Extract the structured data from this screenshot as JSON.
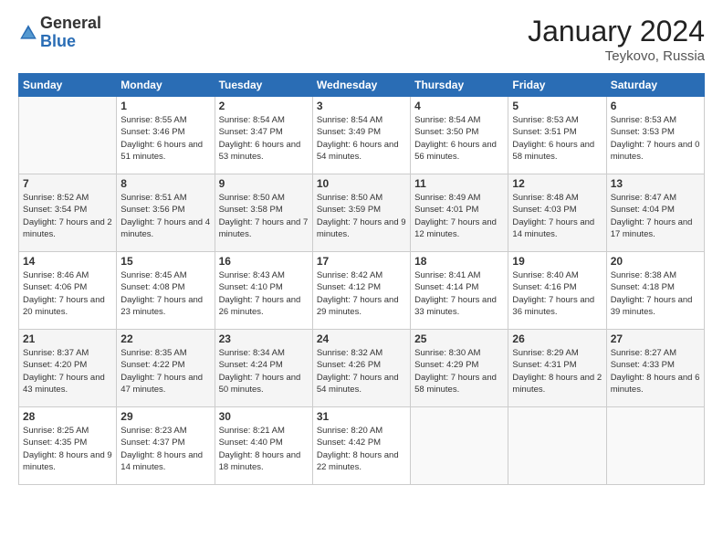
{
  "header": {
    "logo_general": "General",
    "logo_blue": "Blue",
    "month_title": "January 2024",
    "location": "Teykovo, Russia"
  },
  "days_of_week": [
    "Sunday",
    "Monday",
    "Tuesday",
    "Wednesday",
    "Thursday",
    "Friday",
    "Saturday"
  ],
  "weeks": [
    [
      {
        "day": "",
        "sunrise": "",
        "sunset": "",
        "daylight": ""
      },
      {
        "day": "1",
        "sunrise": "Sunrise: 8:55 AM",
        "sunset": "Sunset: 3:46 PM",
        "daylight": "Daylight: 6 hours and 51 minutes."
      },
      {
        "day": "2",
        "sunrise": "Sunrise: 8:54 AM",
        "sunset": "Sunset: 3:47 PM",
        "daylight": "Daylight: 6 hours and 53 minutes."
      },
      {
        "day": "3",
        "sunrise": "Sunrise: 8:54 AM",
        "sunset": "Sunset: 3:49 PM",
        "daylight": "Daylight: 6 hours and 54 minutes."
      },
      {
        "day": "4",
        "sunrise": "Sunrise: 8:54 AM",
        "sunset": "Sunset: 3:50 PM",
        "daylight": "Daylight: 6 hours and 56 minutes."
      },
      {
        "day": "5",
        "sunrise": "Sunrise: 8:53 AM",
        "sunset": "Sunset: 3:51 PM",
        "daylight": "Daylight: 6 hours and 58 minutes."
      },
      {
        "day": "6",
        "sunrise": "Sunrise: 8:53 AM",
        "sunset": "Sunset: 3:53 PM",
        "daylight": "Daylight: 7 hours and 0 minutes."
      }
    ],
    [
      {
        "day": "7",
        "sunrise": "Sunrise: 8:52 AM",
        "sunset": "Sunset: 3:54 PM",
        "daylight": "Daylight: 7 hours and 2 minutes."
      },
      {
        "day": "8",
        "sunrise": "Sunrise: 8:51 AM",
        "sunset": "Sunset: 3:56 PM",
        "daylight": "Daylight: 7 hours and 4 minutes."
      },
      {
        "day": "9",
        "sunrise": "Sunrise: 8:50 AM",
        "sunset": "Sunset: 3:58 PM",
        "daylight": "Daylight: 7 hours and 7 minutes."
      },
      {
        "day": "10",
        "sunrise": "Sunrise: 8:50 AM",
        "sunset": "Sunset: 3:59 PM",
        "daylight": "Daylight: 7 hours and 9 minutes."
      },
      {
        "day": "11",
        "sunrise": "Sunrise: 8:49 AM",
        "sunset": "Sunset: 4:01 PM",
        "daylight": "Daylight: 7 hours and 12 minutes."
      },
      {
        "day": "12",
        "sunrise": "Sunrise: 8:48 AM",
        "sunset": "Sunset: 4:03 PM",
        "daylight": "Daylight: 7 hours and 14 minutes."
      },
      {
        "day": "13",
        "sunrise": "Sunrise: 8:47 AM",
        "sunset": "Sunset: 4:04 PM",
        "daylight": "Daylight: 7 hours and 17 minutes."
      }
    ],
    [
      {
        "day": "14",
        "sunrise": "Sunrise: 8:46 AM",
        "sunset": "Sunset: 4:06 PM",
        "daylight": "Daylight: 7 hours and 20 minutes."
      },
      {
        "day": "15",
        "sunrise": "Sunrise: 8:45 AM",
        "sunset": "Sunset: 4:08 PM",
        "daylight": "Daylight: 7 hours and 23 minutes."
      },
      {
        "day": "16",
        "sunrise": "Sunrise: 8:43 AM",
        "sunset": "Sunset: 4:10 PM",
        "daylight": "Daylight: 7 hours and 26 minutes."
      },
      {
        "day": "17",
        "sunrise": "Sunrise: 8:42 AM",
        "sunset": "Sunset: 4:12 PM",
        "daylight": "Daylight: 7 hours and 29 minutes."
      },
      {
        "day": "18",
        "sunrise": "Sunrise: 8:41 AM",
        "sunset": "Sunset: 4:14 PM",
        "daylight": "Daylight: 7 hours and 33 minutes."
      },
      {
        "day": "19",
        "sunrise": "Sunrise: 8:40 AM",
        "sunset": "Sunset: 4:16 PM",
        "daylight": "Daylight: 7 hours and 36 minutes."
      },
      {
        "day": "20",
        "sunrise": "Sunrise: 8:38 AM",
        "sunset": "Sunset: 4:18 PM",
        "daylight": "Daylight: 7 hours and 39 minutes."
      }
    ],
    [
      {
        "day": "21",
        "sunrise": "Sunrise: 8:37 AM",
        "sunset": "Sunset: 4:20 PM",
        "daylight": "Daylight: 7 hours and 43 minutes."
      },
      {
        "day": "22",
        "sunrise": "Sunrise: 8:35 AM",
        "sunset": "Sunset: 4:22 PM",
        "daylight": "Daylight: 7 hours and 47 minutes."
      },
      {
        "day": "23",
        "sunrise": "Sunrise: 8:34 AM",
        "sunset": "Sunset: 4:24 PM",
        "daylight": "Daylight: 7 hours and 50 minutes."
      },
      {
        "day": "24",
        "sunrise": "Sunrise: 8:32 AM",
        "sunset": "Sunset: 4:26 PM",
        "daylight": "Daylight: 7 hours and 54 minutes."
      },
      {
        "day": "25",
        "sunrise": "Sunrise: 8:30 AM",
        "sunset": "Sunset: 4:29 PM",
        "daylight": "Daylight: 7 hours and 58 minutes."
      },
      {
        "day": "26",
        "sunrise": "Sunrise: 8:29 AM",
        "sunset": "Sunset: 4:31 PM",
        "daylight": "Daylight: 8 hours and 2 minutes."
      },
      {
        "day": "27",
        "sunrise": "Sunrise: 8:27 AM",
        "sunset": "Sunset: 4:33 PM",
        "daylight": "Daylight: 8 hours and 6 minutes."
      }
    ],
    [
      {
        "day": "28",
        "sunrise": "Sunrise: 8:25 AM",
        "sunset": "Sunset: 4:35 PM",
        "daylight": "Daylight: 8 hours and 9 minutes."
      },
      {
        "day": "29",
        "sunrise": "Sunrise: 8:23 AM",
        "sunset": "Sunset: 4:37 PM",
        "daylight": "Daylight: 8 hours and 14 minutes."
      },
      {
        "day": "30",
        "sunrise": "Sunrise: 8:21 AM",
        "sunset": "Sunset: 4:40 PM",
        "daylight": "Daylight: 8 hours and 18 minutes."
      },
      {
        "day": "31",
        "sunrise": "Sunrise: 8:20 AM",
        "sunset": "Sunset: 4:42 PM",
        "daylight": "Daylight: 8 hours and 22 minutes."
      },
      {
        "day": "",
        "sunrise": "",
        "sunset": "",
        "daylight": ""
      },
      {
        "day": "",
        "sunrise": "",
        "sunset": "",
        "daylight": ""
      },
      {
        "day": "",
        "sunrise": "",
        "sunset": "",
        "daylight": ""
      }
    ]
  ]
}
